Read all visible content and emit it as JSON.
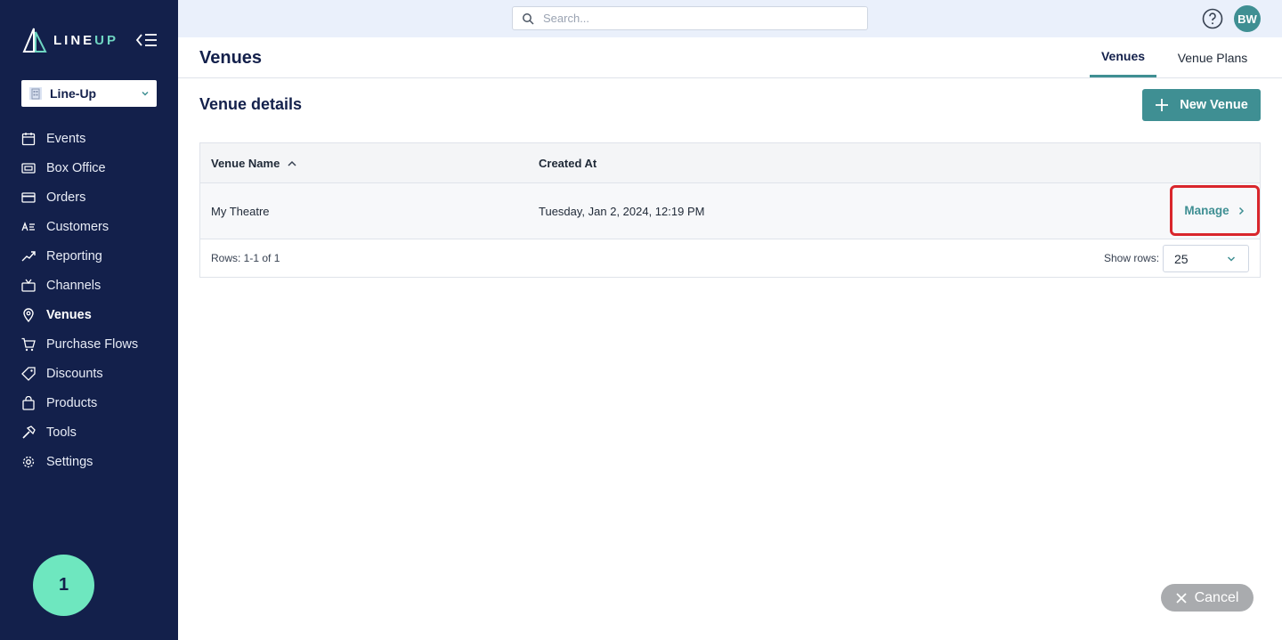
{
  "brand": {
    "logo_text_a": "LINE",
    "logo_text_b": "UP"
  },
  "org_selector": {
    "value": "Line-Up"
  },
  "sidebar": {
    "items": [
      {
        "label": "Events",
        "icon": "calendar-icon"
      },
      {
        "label": "Box Office",
        "icon": "ticket-icon"
      },
      {
        "label": "Orders",
        "icon": "credit-card-icon"
      },
      {
        "label": "Customers",
        "icon": "contact-card-icon"
      },
      {
        "label": "Reporting",
        "icon": "chart-line-icon"
      },
      {
        "label": "Channels",
        "icon": "tv-icon"
      },
      {
        "label": "Venues",
        "icon": "map-pin-icon",
        "active": true
      },
      {
        "label": "Purchase Flows",
        "icon": "cart-icon"
      },
      {
        "label": "Discounts",
        "icon": "tag-icon"
      },
      {
        "label": "Products",
        "icon": "shopping-bag-icon"
      },
      {
        "label": "Tools",
        "icon": "hammer-icon"
      },
      {
        "label": "Settings",
        "icon": "gear-icon"
      }
    ]
  },
  "step_badge": "1",
  "topbar": {
    "search_placeholder": "Search...",
    "avatar_initials": "BW"
  },
  "page": {
    "title": "Venues",
    "tabs": [
      {
        "label": "Venues",
        "active": true
      },
      {
        "label": "Venue Plans",
        "active": false
      }
    ]
  },
  "section": {
    "title": "Venue details",
    "new_button_label": "New Venue"
  },
  "table": {
    "columns": [
      "Venue Name",
      "Created At"
    ],
    "rows": [
      {
        "name": "My Theatre",
        "created_at": "Tuesday, Jan 2, 2024, 12:19 PM",
        "action": "Manage"
      }
    ],
    "rows_info": "Rows: 1-1 of 1",
    "show_rows_label": "Show rows:",
    "rows_per_page": "25"
  },
  "cancel_label": "Cancel",
  "colors": {
    "sidebar_bg": "#13204b",
    "accent": "#3f8f93",
    "highlight": "#d9262c",
    "badge": "#6ee7bf"
  }
}
